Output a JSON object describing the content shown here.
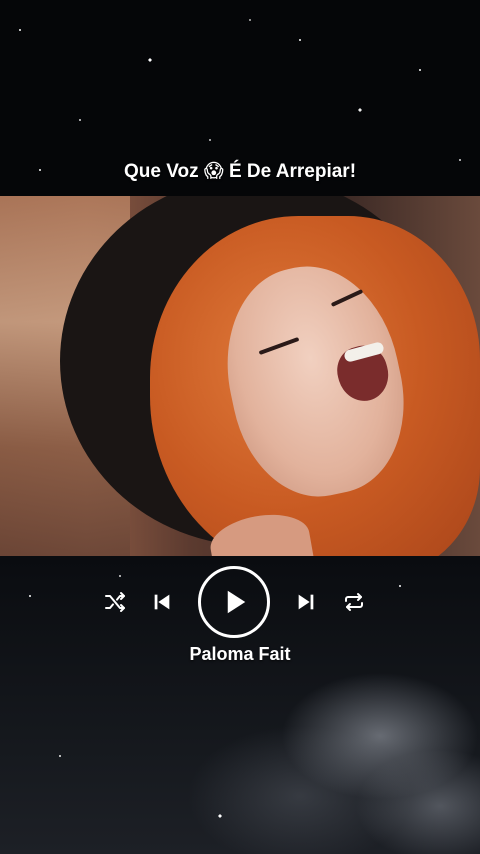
{
  "caption": {
    "text_before": "Que Voz",
    "emoji": "😱",
    "text_after": "É De Arrepiar!"
  },
  "player": {
    "artist": "Paloma Fait",
    "icons": {
      "shuffle": "shuffle-icon",
      "previous": "skip-previous-icon",
      "play": "play-icon",
      "next": "skip-next-icon",
      "repeat": "repeat-icon"
    }
  },
  "colors": {
    "background": "#050608",
    "text": "#ffffff",
    "hair": "#c85a22"
  }
}
